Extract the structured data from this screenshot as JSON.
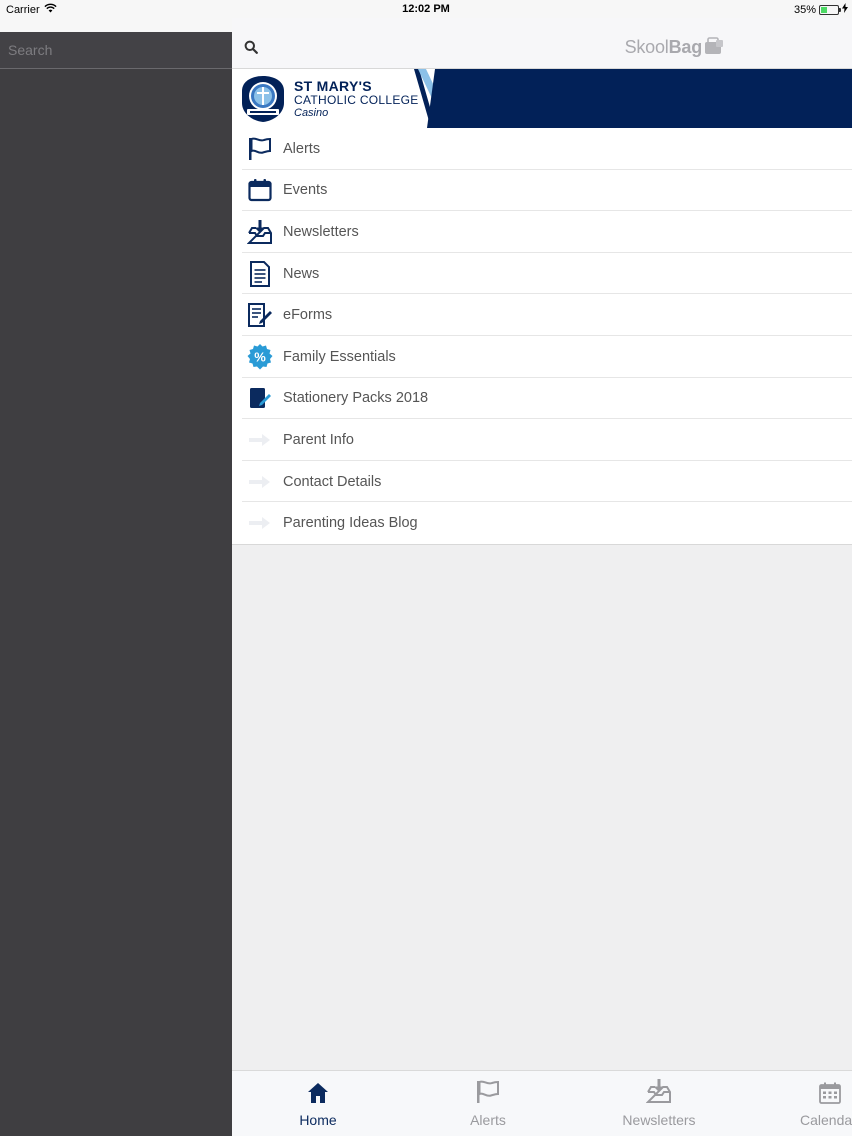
{
  "status_bar": {
    "carrier": "Carrier",
    "time": "12:02 PM",
    "battery": "35%",
    "battery_level": 0.35
  },
  "drawer": {
    "search_placeholder": "Search"
  },
  "header": {
    "brand_light": "Skool",
    "brand_bold": "Bag"
  },
  "banner": {
    "school_line1": "ST MARY'S",
    "school_line2": "CATHOLIC COLLEGE",
    "school_line3": "Casino",
    "colors": {
      "navy": "#022158",
      "light_blue": "#8cc1e8"
    }
  },
  "menu": {
    "items": [
      {
        "label": "Alerts",
        "icon": "flag-icon"
      },
      {
        "label": "Events",
        "icon": "calendar-icon"
      },
      {
        "label": "Newsletters",
        "icon": "inbox-download-icon"
      },
      {
        "label": "News",
        "icon": "document-icon"
      },
      {
        "label": "eForms",
        "icon": "form-pencil-icon"
      },
      {
        "label": "Family Essentials",
        "icon": "percent-badge-icon"
      },
      {
        "label": "Stationery Packs 2018",
        "icon": "notepad-pen-icon"
      },
      {
        "label": "Parent Info",
        "icon": "arrow-right-icon"
      },
      {
        "label": "Contact Details",
        "icon": "arrow-right-icon"
      },
      {
        "label": "Parenting Ideas Blog",
        "icon": "arrow-right-icon"
      }
    ]
  },
  "tabbar": {
    "tabs": [
      {
        "label": "Home",
        "icon": "home-icon",
        "active": true
      },
      {
        "label": "Alerts",
        "icon": "flag-icon",
        "active": false
      },
      {
        "label": "Newsletters",
        "icon": "inbox-download-icon",
        "active": false
      },
      {
        "label": "Calendar",
        "icon": "calendar-grid-icon",
        "active": false
      }
    ]
  }
}
